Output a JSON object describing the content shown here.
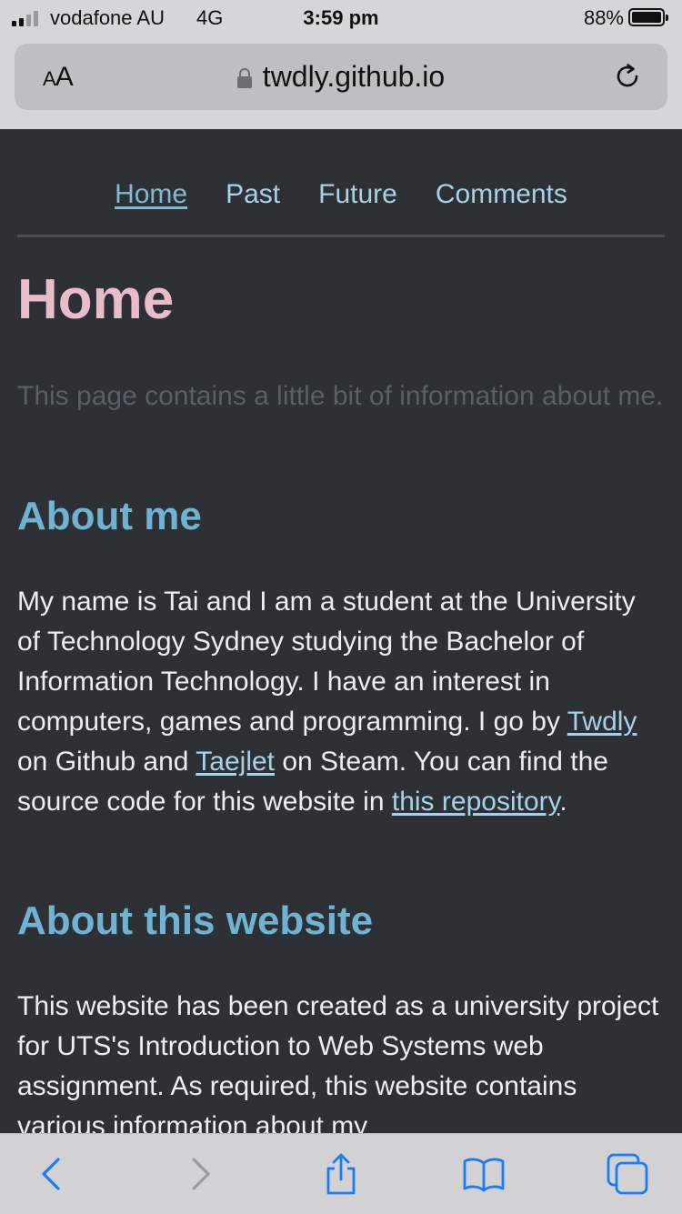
{
  "status_bar": {
    "carrier": "vodafone AU",
    "network": "4G",
    "time": "3:59 pm",
    "battery_percent": "88%",
    "battery_level": 0.88
  },
  "address_bar": {
    "text_size_label": "AA",
    "url": "twdly.github.io",
    "lock_icon": "lock-icon",
    "reload_icon": "reload-icon"
  },
  "nav": {
    "items": [
      {
        "label": "Home",
        "active": true
      },
      {
        "label": "Past",
        "active": false
      },
      {
        "label": "Future",
        "active": false
      },
      {
        "label": "Comments",
        "active": false
      }
    ]
  },
  "content": {
    "title": "Home",
    "lead": "This page contains a little bit of information about me.",
    "about_heading": "About me",
    "about": {
      "text1": "My name is Tai and I am a student at the University of Technology Sydney studying the Bachelor of Information Technology. I have an interest in computers, games and programming. I go by ",
      "link_github": "Twdly",
      "text2": " on Github and ",
      "link_steam": "Taejlet",
      "text3": " on Steam. You can find the source code for this website in ",
      "link_repo": "this repository",
      "text4": "."
    },
    "site_heading": "About this website",
    "site_text": "This website has been created as a university project for UTS's Introduction to Web Systems web assignment. As required, this website contains various information about my"
  },
  "toolbar": {
    "icons": [
      "back-icon",
      "forward-icon",
      "share-icon",
      "bookmarks-icon",
      "tabs-icon"
    ]
  },
  "colors": {
    "page_background": "#2d3035",
    "title_pink": "#e8bcc8",
    "heading_blue": "#6fb3d2",
    "link_blue": "#a7d2e6",
    "muted_text": "#585f66",
    "ios_blue": "#1a7cf5"
  }
}
